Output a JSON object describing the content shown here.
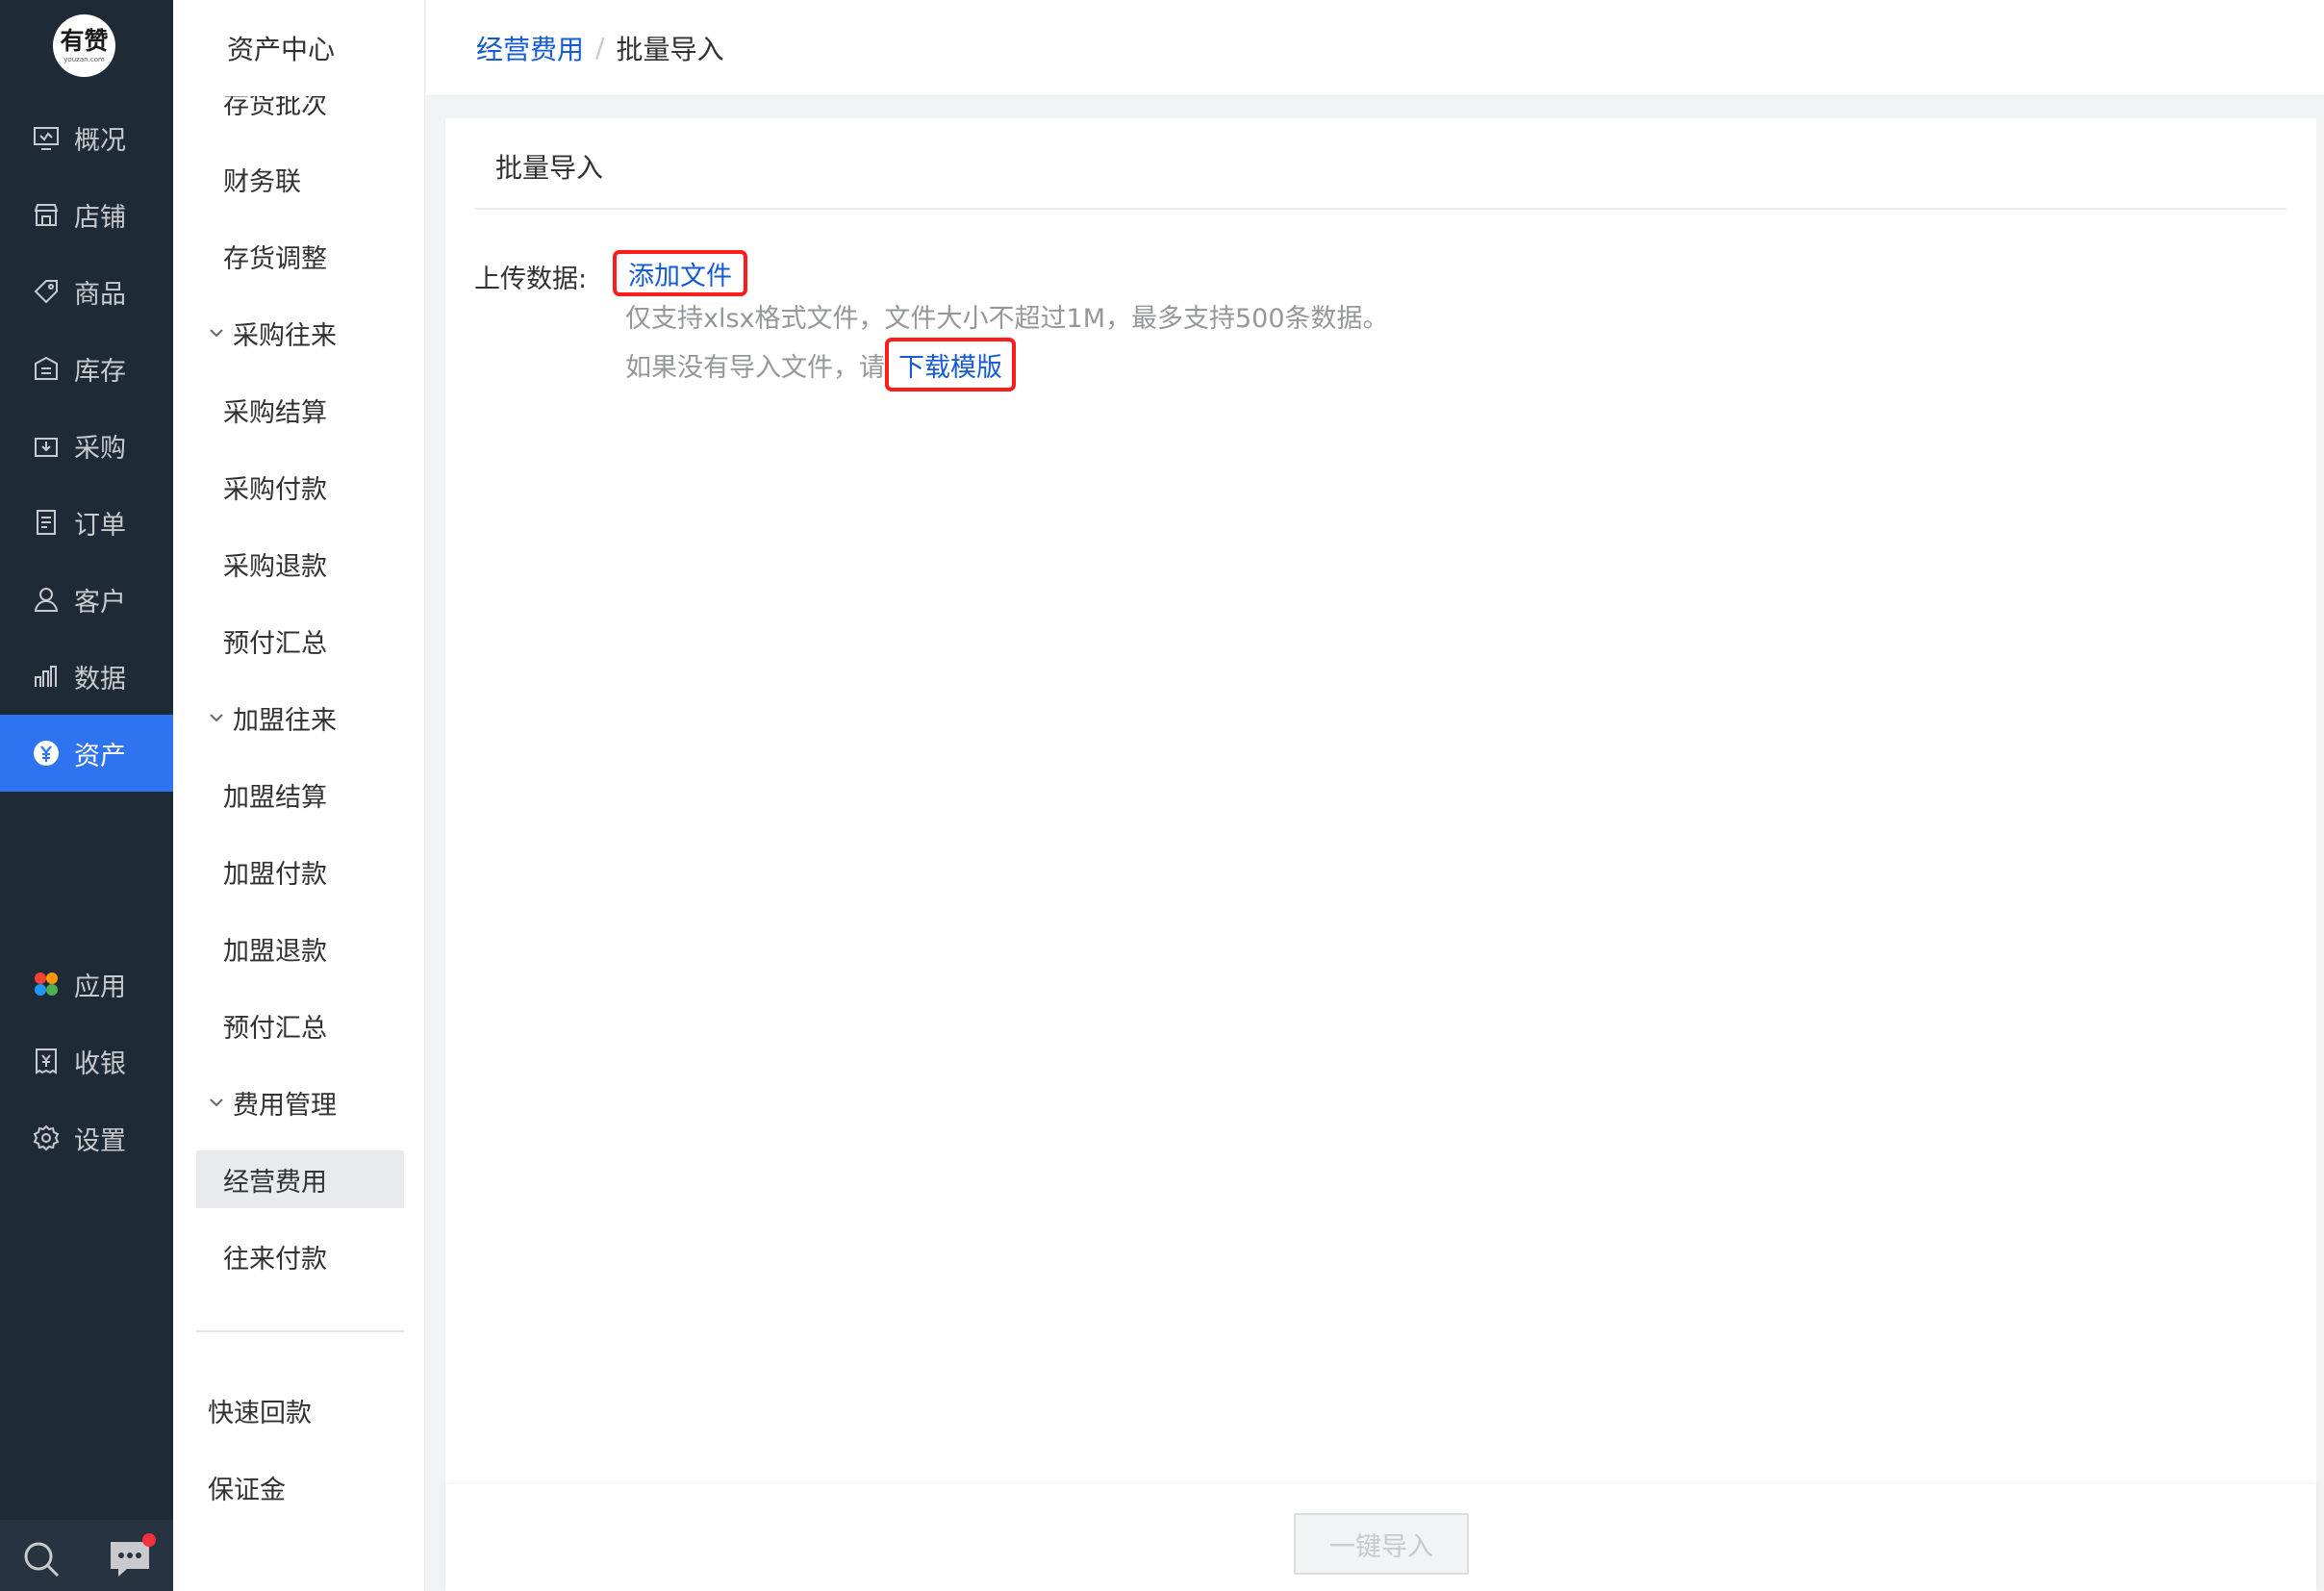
{
  "logo": {
    "text": "有赞",
    "sub": "youzan.com"
  },
  "nav": {
    "items": [
      {
        "label": "概况",
        "icon": "overview-icon"
      },
      {
        "label": "店铺",
        "icon": "store-icon"
      },
      {
        "label": "商品",
        "icon": "tag-icon"
      },
      {
        "label": "库存",
        "icon": "warehouse-icon"
      },
      {
        "label": "采购",
        "icon": "purchase-icon"
      },
      {
        "label": "订单",
        "icon": "order-icon"
      },
      {
        "label": "客户",
        "icon": "customer-icon"
      },
      {
        "label": "数据",
        "icon": "data-chart-icon"
      },
      {
        "label": "资产",
        "icon": "yuan-icon"
      },
      {
        "label": "应用",
        "icon": "apps-icon"
      },
      {
        "label": "收银",
        "icon": "cashier-icon"
      },
      {
        "label": "设置",
        "icon": "gear-icon"
      }
    ],
    "active": "资产",
    "accent": "#2e74f0",
    "background": "#1f2a37"
  },
  "sidebar": {
    "title": "资产中心",
    "items": [
      {
        "label": "存货批次",
        "type": "child"
      },
      {
        "label": "财务联",
        "type": "child"
      },
      {
        "label": "存货调整",
        "type": "child"
      },
      {
        "label": "采购往来",
        "type": "group"
      },
      {
        "label": "采购结算",
        "type": "child"
      },
      {
        "label": "采购付款",
        "type": "child"
      },
      {
        "label": "采购退款",
        "type": "child"
      },
      {
        "label": "预付汇总",
        "type": "child"
      },
      {
        "label": "加盟往来",
        "type": "group"
      },
      {
        "label": "加盟结算",
        "type": "child"
      },
      {
        "label": "加盟付款",
        "type": "child"
      },
      {
        "label": "加盟退款",
        "type": "child"
      },
      {
        "label": "预付汇总",
        "type": "child"
      },
      {
        "label": "费用管理",
        "type": "group"
      },
      {
        "label": "经营费用",
        "type": "child",
        "selected": true
      },
      {
        "label": "往来付款",
        "type": "child"
      },
      {
        "label": "快速回款",
        "type": "plain"
      },
      {
        "label": "保证金",
        "type": "plain"
      }
    ]
  },
  "breadcrumb": {
    "parent": "经营费用",
    "separator": "/",
    "current": "批量导入"
  },
  "card": {
    "title": "批量导入",
    "upload_label": "上传数据:",
    "add_file": "添加文件",
    "hint1": "仅支持xlsx格式文件，文件大小不超过1M，最多支持500条数据。",
    "hint2_prefix": "如果没有导入文件，请",
    "download_template": "下载模版"
  },
  "footer": {
    "import_button": "一键导入"
  },
  "colors": {
    "link": "#155bd4",
    "highlight_box": "#ff1b1b"
  }
}
